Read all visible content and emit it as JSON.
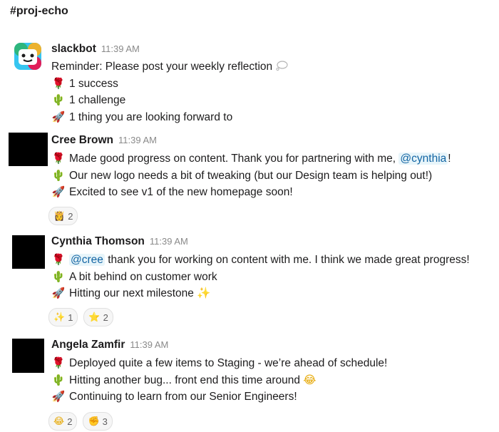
{
  "channel": {
    "name": "#proj-echo"
  },
  "messages": [
    {
      "author": "slackbot",
      "time": "11:39 AM",
      "lines": [
        {
          "prefix": "Reminder: Please post your weekly reflection",
          "suffix_icon": "thought-balloon"
        },
        {
          "icon": "rose",
          "text": "1 success"
        },
        {
          "icon": "cactus",
          "text": "1 challenge"
        },
        {
          "icon": "rocket",
          "text": "1 thing you are looking forward to"
        }
      ]
    },
    {
      "author": "Cree Brown",
      "time": "11:39 AM",
      "lines": [
        {
          "icon": "rose",
          "text": "Made good progress on content. Thank you for partnering with me,",
          "mention": "@cynthia",
          "after": "!"
        },
        {
          "icon": "cactus",
          "text": "Our new logo needs a bit of tweaking (but our Design team is helping out!)"
        },
        {
          "icon": "rocket",
          "text": "Excited to see v1 of the new homepage soon!"
        }
      ],
      "reactions": [
        {
          "icon": "crown-person",
          "count": "2"
        }
      ]
    },
    {
      "author": "Cynthia Thomson",
      "time": "11:39 AM",
      "lines": [
        {
          "icon": "rose",
          "mention": "@cree",
          "text": "thank you for working on content with me. I think we made great progress!"
        },
        {
          "icon": "cactus",
          "text": "A bit behind on customer work"
        },
        {
          "icon": "rocket",
          "text": "Hitting our next milestone",
          "suffix_icon": "sparkles"
        }
      ],
      "reactions": [
        {
          "icon": "sparkles",
          "count": "1"
        },
        {
          "icon": "star",
          "count": "2"
        }
      ]
    },
    {
      "author": "Angela Zamfir",
      "time": "11:39 AM",
      "lines": [
        {
          "icon": "rose",
          "text": "Deployed quite a few items to Staging - we’re ahead of schedule!"
        },
        {
          "icon": "cactus",
          "text": "Hitting another bug... front end this time around",
          "suffix_icon": "joy"
        },
        {
          "icon": "rocket",
          "text": "Continuing to learn from our Senior Engineers!"
        }
      ],
      "reactions": [
        {
          "icon": "joy",
          "count": "2"
        },
        {
          "icon": "fist",
          "count": "3"
        }
      ]
    }
  ]
}
